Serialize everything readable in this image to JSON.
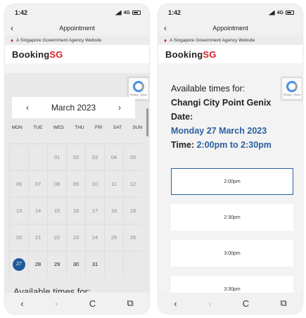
{
  "left": {
    "status": {
      "time": "1:42",
      "network": "4G"
    },
    "nav": {
      "back": "‹",
      "title": "Appointment"
    },
    "gov_banner": "A Singapore Government Agency Website",
    "brand": {
      "a": "Booking",
      "b": "SG"
    },
    "recaptcha": "Privacy · Terms",
    "calendar": {
      "prev": "‹",
      "next": "›",
      "month": "March 2023",
      "weekdays": [
        "MON",
        "TUE",
        "WED",
        "THU",
        "FRI",
        "SAT",
        "SUN"
      ],
      "rows": [
        [
          "",
          "",
          "01",
          "02",
          "03",
          "04",
          "05"
        ],
        [
          "06",
          "07",
          "08",
          "09",
          "10",
          "11",
          "12"
        ],
        [
          "13",
          "14",
          "15",
          "16",
          "17",
          "18",
          "19"
        ],
        [
          "20",
          "21",
          "22",
          "23",
          "24",
          "25",
          "26"
        ],
        [
          "27",
          "28",
          "29",
          "30",
          "31",
          "",
          ""
        ]
      ],
      "selected": "27"
    },
    "peek_text": "Available times for:",
    "bottom": {
      "back": "‹",
      "forward": "›",
      "reload": "C",
      "share": "⧉"
    }
  },
  "right": {
    "status": {
      "time": "1:42",
      "network": "4G"
    },
    "nav": {
      "back": "‹",
      "title": "Appointment"
    },
    "gov_banner": "A Singapore Government Agency Website",
    "brand": {
      "a": "Booking",
      "b": "SG"
    },
    "recaptcha": "Privacy · Terms",
    "heading": {
      "line1": "Available times for:",
      "place": "Changi City Point Genix",
      "date_label": "Date:",
      "date_value": "Monday 27 March 2023",
      "time_label": "Time:",
      "time_value": "2:00pm to 2:30pm"
    },
    "slots": [
      "2:00pm",
      "2:30pm",
      "3:00pm",
      "3:30pm"
    ],
    "bottom": {
      "back": "‹",
      "forward": "›",
      "reload": "C",
      "share": "⧉"
    }
  }
}
